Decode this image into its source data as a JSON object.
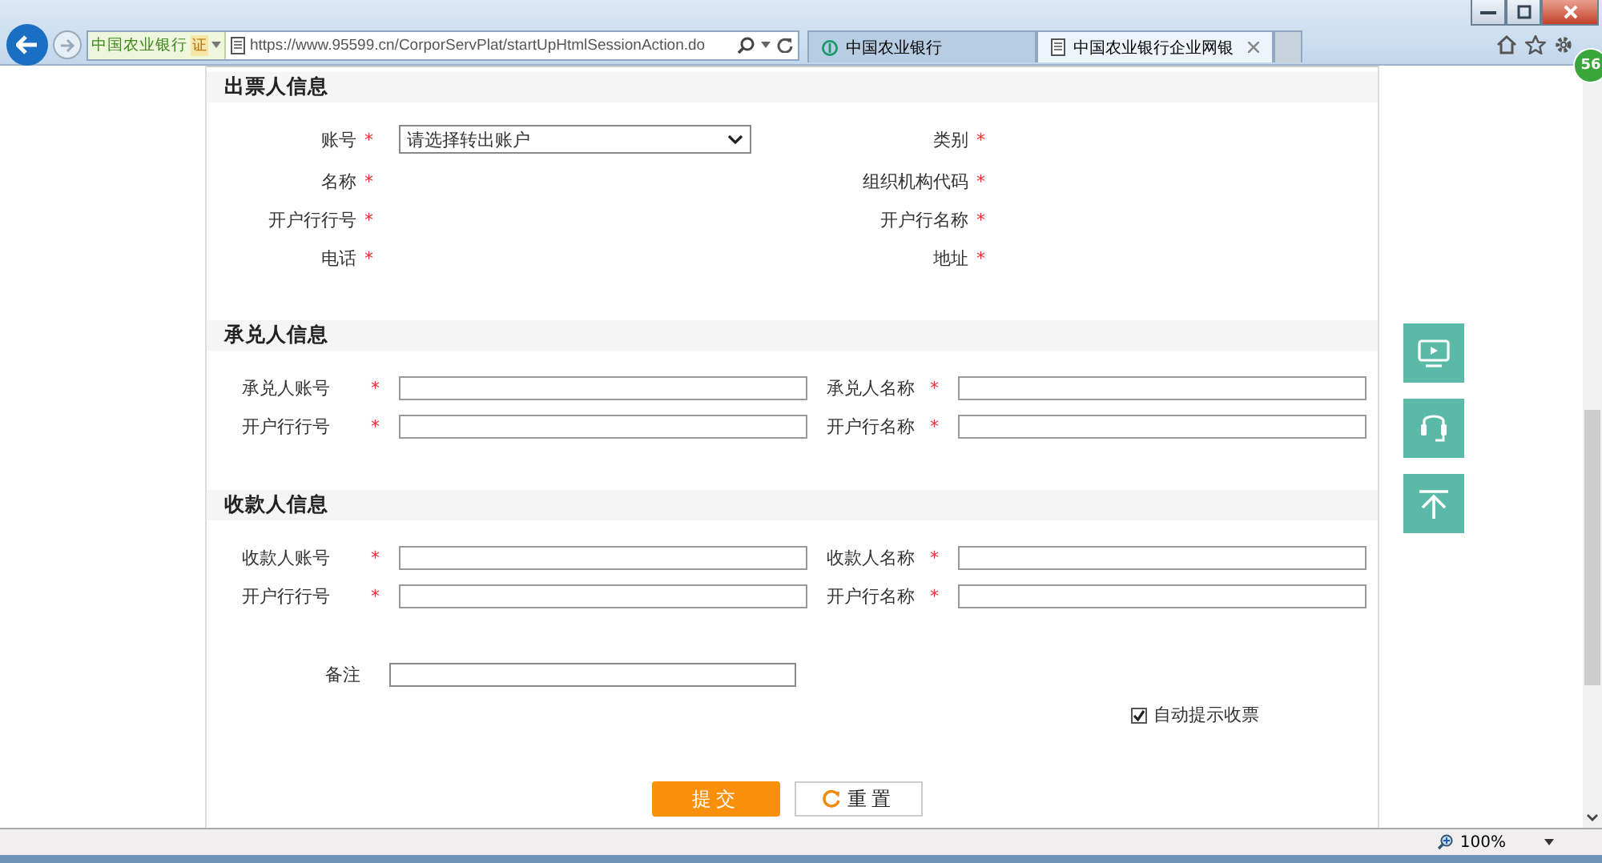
{
  "browser": {
    "address": {
      "site_label": "中国农业银行",
      "cert_badge": "证",
      "url": "https://www.95599.cn/CorporServPlat/startUpHtmlSessionAction.do"
    },
    "tabs": [
      {
        "label": "中国农业银行",
        "selected": false,
        "kind": "site"
      },
      {
        "label": "中国农业银行企业网银",
        "selected": true,
        "kind": "page"
      }
    ],
    "badge": "56"
  },
  "sections": [
    {
      "title": "出票人信息",
      "kind": "info",
      "fields": [
        {
          "label": "账号",
          "required": true,
          "required_mark": "*",
          "kind": "select",
          "value": "请选择转出账户"
        },
        {
          "label": "类别",
          "required": true,
          "required_mark": "*",
          "kind": "static"
        },
        {
          "label": "名称",
          "required": true,
          "required_mark": "*",
          "kind": "static"
        },
        {
          "label": "组织机构代码",
          "required": true,
          "required_mark": "*",
          "kind": "static"
        },
        {
          "label": "开户行行号",
          "required": true,
          "required_mark": "*",
          "kind": "static"
        },
        {
          "label": "开户行名称",
          "required": true,
          "required_mark": "*",
          "kind": "static"
        },
        {
          "label": "电话",
          "required": true,
          "required_mark": "*",
          "kind": "static"
        },
        {
          "label": "地址",
          "required": true,
          "required_mark": "*",
          "kind": "static"
        }
      ]
    },
    {
      "title": "承兑人信息",
      "kind": "form",
      "fields": [
        {
          "label": "承兑人账号",
          "required": true,
          "required_mark": "*",
          "kind": "text"
        },
        {
          "label": "承兑人名称",
          "required": true,
          "required_mark": "*",
          "kind": "text"
        },
        {
          "label": "开户行行号",
          "required": true,
          "required_mark": "*",
          "kind": "text"
        },
        {
          "label": "开户行名称",
          "required": true,
          "required_mark": "*",
          "kind": "text"
        }
      ]
    },
    {
      "title": "收款人信息",
      "kind": "form",
      "fields": [
        {
          "label": "收款人账号",
          "required": true,
          "required_mark": "*",
          "kind": "text"
        },
        {
          "label": "收款人名称",
          "required": true,
          "required_mark": "*",
          "kind": "text"
        },
        {
          "label": "开户行行号",
          "required": true,
          "required_mark": "*",
          "kind": "text"
        },
        {
          "label": "开户行名称",
          "required": true,
          "required_mark": "*",
          "kind": "text"
        }
      ]
    }
  ],
  "remark": {
    "label": "备注"
  },
  "auto_prompt": {
    "label": "自动提示收票",
    "checked": true
  },
  "buttons": [
    {
      "label": "提交",
      "kind": "primary"
    },
    {
      "label": "重置",
      "kind": "reset"
    }
  ],
  "status_bar": {
    "zoom": "100%"
  }
}
